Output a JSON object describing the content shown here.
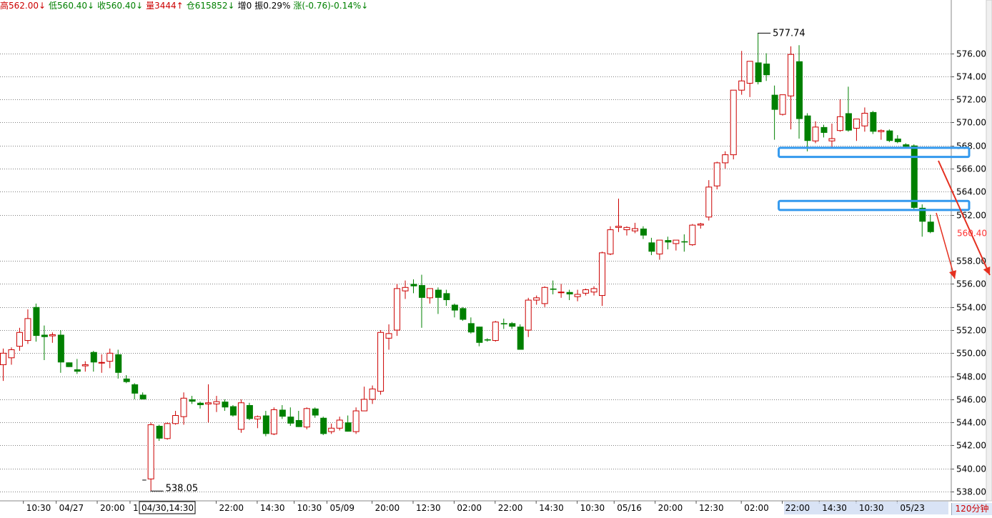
{
  "info_bar": {
    "high": "高562.00↓",
    "low": "低560.40↓",
    "close": "收560.40↓",
    "volume": "量3444↑",
    "open_interest": "仓615852↓",
    "increase": "增0",
    "amplitude": "振0.29%",
    "change": "涨(-0.76)-0.14%↓"
  },
  "timeframe_label": "120分钟",
  "current_price_label": "560.40",
  "high_marker": "577.74",
  "low_marker": "538.05",
  "cursor_time_label": "04/30,14:30",
  "colors": {
    "up": "#cc0000",
    "down": "#008000",
    "grid": "#808080",
    "highlight_box": "#3399ee",
    "arrow": "#e53020",
    "axis_text": "#000000"
  },
  "chart_data": {
    "type": "candlestick",
    "title": "",
    "xlabel": "",
    "ylabel": "",
    "ylim": [
      537.2,
      579.5
    ],
    "grid": true,
    "y_ticks": [
      "576.00",
      "574.00",
      "572.00",
      "570.00",
      "568.00",
      "566.00",
      "564.00",
      "562.00",
      "558.00",
      "556.00",
      "554.00",
      "552.00",
      "550.00",
      "548.00",
      "546.00",
      "544.00",
      "542.00",
      "540.00",
      "538.00"
    ],
    "x_ticks": [
      "10:30",
      "04/27",
      "20:00",
      "1",
      "22:00",
      "14:30",
      "10:30",
      "05/09",
      "20:00",
      "12:30",
      "02:00",
      "22:00",
      "14:30",
      "10:30",
      "05/16",
      "20:00",
      "12:30",
      "02:00",
      "22:00",
      "14:30",
      "10:30",
      "05/23"
    ],
    "x_tick_bars": [
      2.5,
      6.5,
      11.5,
      15.5,
      26,
      31,
      35.5,
      39.5,
      45,
      50,
      55,
      60,
      65,
      70,
      74.5,
      79.5,
      84.5,
      90,
      95,
      99.5,
      104,
      109
    ],
    "candles": [
      {
        "o": 549.0,
        "h": 550.4,
        "l": 547.6,
        "c": 550.0
      },
      {
        "o": 549.6,
        "h": 550.5,
        "l": 549.0,
        "c": 550.3
      },
      {
        "o": 550.6,
        "h": 552.2,
        "l": 550.2,
        "c": 551.8
      },
      {
        "o": 551.1,
        "h": 553.8,
        "l": 550.8,
        "c": 553.0
      },
      {
        "o": 554.0,
        "h": 554.3,
        "l": 551.0,
        "c": 551.5
      },
      {
        "o": 551.6,
        "h": 552.4,
        "l": 549.4,
        "c": 551.4
      },
      {
        "o": 551.5,
        "h": 551.8,
        "l": 550.9,
        "c": 551.6
      },
      {
        "o": 551.6,
        "h": 552.0,
        "l": 548.3,
        "c": 549.2
      },
      {
        "o": 549.2,
        "h": 549.2,
        "l": 548.8,
        "c": 548.8
      },
      {
        "o": 548.6,
        "h": 549.5,
        "l": 548.2,
        "c": 548.4
      },
      {
        "o": 548.9,
        "h": 549.3,
        "l": 548.4,
        "c": 549.0
      },
      {
        "o": 550.1,
        "h": 550.2,
        "l": 548.4,
        "c": 549.2
      },
      {
        "o": 549.2,
        "h": 549.9,
        "l": 548.3,
        "c": 549.2
      },
      {
        "o": 549.3,
        "h": 550.4,
        "l": 548.7,
        "c": 550.0
      },
      {
        "o": 549.9,
        "h": 550.3,
        "l": 547.8,
        "c": 548.3
      },
      {
        "o": 547.8,
        "h": 548.1,
        "l": 547.4,
        "c": 547.5
      },
      {
        "o": 547.3,
        "h": 547.4,
        "l": 546.0,
        "c": 546.5
      },
      {
        "o": 546.4,
        "h": 546.6,
        "l": 546.0,
        "c": 546.0
      },
      {
        "o": 539.1,
        "h": 544.0,
        "l": 538.05,
        "c": 543.8
      },
      {
        "o": 543.7,
        "h": 543.8,
        "l": 542.4,
        "c": 542.6
      },
      {
        "o": 542.6,
        "h": 544.0,
        "l": 542.5,
        "c": 543.9
      },
      {
        "o": 543.9,
        "h": 545.0,
        "l": 543.8,
        "c": 544.6
      },
      {
        "o": 544.5,
        "h": 546.6,
        "l": 543.8,
        "c": 546.1
      },
      {
        "o": 546.0,
        "h": 546.3,
        "l": 545.6,
        "c": 545.8
      },
      {
        "o": 545.7,
        "h": 545.8,
        "l": 545.2,
        "c": 545.5
      },
      {
        "o": 545.6,
        "h": 547.3,
        "l": 544.0,
        "c": 545.7
      },
      {
        "o": 545.6,
        "h": 546.3,
        "l": 544.9,
        "c": 545.8
      },
      {
        "o": 545.8,
        "h": 546.0,
        "l": 545.0,
        "c": 545.3
      },
      {
        "o": 545.4,
        "h": 545.5,
        "l": 544.5,
        "c": 544.6
      },
      {
        "o": 543.4,
        "h": 546.0,
        "l": 543.1,
        "c": 545.7
      },
      {
        "o": 545.5,
        "h": 545.7,
        "l": 544.2,
        "c": 544.3
      },
      {
        "o": 544.3,
        "h": 544.6,
        "l": 543.5,
        "c": 544.5
      },
      {
        "o": 544.6,
        "h": 545.0,
        "l": 542.8,
        "c": 543.0
      },
      {
        "o": 543.0,
        "h": 545.3,
        "l": 542.9,
        "c": 545.1
      },
      {
        "o": 545.1,
        "h": 545.5,
        "l": 544.3,
        "c": 544.5
      },
      {
        "o": 544.5,
        "h": 545.3,
        "l": 543.7,
        "c": 543.9
      },
      {
        "o": 544.2,
        "h": 545.0,
        "l": 543.6,
        "c": 543.6
      },
      {
        "o": 543.6,
        "h": 545.3,
        "l": 543.4,
        "c": 545.2
      },
      {
        "o": 545.2,
        "h": 545.3,
        "l": 544.4,
        "c": 544.6
      },
      {
        "o": 544.4,
        "h": 544.5,
        "l": 542.9,
        "c": 543.0
      },
      {
        "o": 543.2,
        "h": 543.9,
        "l": 543.0,
        "c": 543.5
      },
      {
        "o": 543.5,
        "h": 544.5,
        "l": 543.3,
        "c": 544.2
      },
      {
        "o": 544.0,
        "h": 544.6,
        "l": 543.2,
        "c": 543.2
      },
      {
        "o": 543.2,
        "h": 545.3,
        "l": 543.0,
        "c": 545.0
      },
      {
        "o": 545.0,
        "h": 547.1,
        "l": 545.0,
        "c": 546.0
      },
      {
        "o": 546.0,
        "h": 547.2,
        "l": 545.6,
        "c": 546.9
      },
      {
        "o": 546.7,
        "h": 552.0,
        "l": 546.4,
        "c": 551.8
      },
      {
        "o": 551.3,
        "h": 552.5,
        "l": 550.3,
        "c": 551.7
      },
      {
        "o": 552.0,
        "h": 556.0,
        "l": 551.5,
        "c": 555.6
      },
      {
        "o": 555.4,
        "h": 556.3,
        "l": 554.7,
        "c": 555.7
      },
      {
        "o": 556.0,
        "h": 556.4,
        "l": 555.2,
        "c": 555.8
      },
      {
        "o": 555.9,
        "h": 556.8,
        "l": 552.2,
        "c": 554.8
      },
      {
        "o": 554.8,
        "h": 555.5,
        "l": 554.3,
        "c": 555.6
      },
      {
        "o": 555.5,
        "h": 555.7,
        "l": 553.4,
        "c": 554.8
      },
      {
        "o": 555.2,
        "h": 555.5,
        "l": 554.1,
        "c": 554.6
      },
      {
        "o": 554.2,
        "h": 554.3,
        "l": 553.1,
        "c": 553.7
      },
      {
        "o": 553.9,
        "h": 554.0,
        "l": 552.8,
        "c": 552.9
      },
      {
        "o": 552.6,
        "h": 553.1,
        "l": 551.7,
        "c": 551.8
      },
      {
        "o": 552.3,
        "h": 552.3,
        "l": 550.6,
        "c": 550.9
      },
      {
        "o": 551.2,
        "h": 551.3,
        "l": 551.0,
        "c": 551.1
      },
      {
        "o": 551.1,
        "h": 552.8,
        "l": 551.0,
        "c": 552.7
      },
      {
        "o": 552.6,
        "h": 553.0,
        "l": 552.1,
        "c": 552.5
      },
      {
        "o": 552.6,
        "h": 552.7,
        "l": 552.1,
        "c": 552.3
      },
      {
        "o": 552.3,
        "h": 552.5,
        "l": 550.3,
        "c": 550.3
      },
      {
        "o": 552.0,
        "h": 554.8,
        "l": 551.4,
        "c": 554.6
      },
      {
        "o": 554.6,
        "h": 555.0,
        "l": 554.2,
        "c": 554.8
      },
      {
        "o": 554.3,
        "h": 555.8,
        "l": 554.0,
        "c": 555.7
      },
      {
        "o": 555.6,
        "h": 556.3,
        "l": 555.1,
        "c": 555.5
      },
      {
        "o": 555.3,
        "h": 556.0,
        "l": 554.8,
        "c": 555.3
      },
      {
        "o": 555.3,
        "h": 555.5,
        "l": 554.6,
        "c": 555.1
      },
      {
        "o": 554.9,
        "h": 555.5,
        "l": 554.5,
        "c": 555.1
      },
      {
        "o": 555.2,
        "h": 555.6,
        "l": 555.0,
        "c": 555.5
      },
      {
        "o": 555.3,
        "h": 555.8,
        "l": 555.0,
        "c": 555.6
      },
      {
        "o": 555.0,
        "h": 558.8,
        "l": 554.1,
        "c": 558.7
      },
      {
        "o": 558.6,
        "h": 561.0,
        "l": 558.5,
        "c": 560.7
      },
      {
        "o": 560.9,
        "h": 563.4,
        "l": 560.5,
        "c": 561.0
      },
      {
        "o": 560.7,
        "h": 561.0,
        "l": 560.2,
        "c": 560.9
      },
      {
        "o": 560.6,
        "h": 561.3,
        "l": 560.4,
        "c": 560.8
      },
      {
        "o": 560.8,
        "h": 561.0,
        "l": 559.9,
        "c": 560.2
      },
      {
        "o": 559.6,
        "h": 560.0,
        "l": 558.5,
        "c": 558.8
      },
      {
        "o": 558.6,
        "h": 559.8,
        "l": 558.1,
        "c": 559.8
      },
      {
        "o": 559.8,
        "h": 560.1,
        "l": 559.0,
        "c": 559.6
      },
      {
        "o": 559.5,
        "h": 559.8,
        "l": 558.9,
        "c": 559.8
      },
      {
        "o": 559.7,
        "h": 560.3,
        "l": 558.8,
        "c": 559.6
      },
      {
        "o": 559.4,
        "h": 561.2,
        "l": 559.3,
        "c": 561.1
      },
      {
        "o": 561.1,
        "h": 561.3,
        "l": 560.8,
        "c": 561.2
      },
      {
        "o": 561.8,
        "h": 565.0,
        "l": 561.5,
        "c": 564.4
      },
      {
        "o": 564.5,
        "h": 566.6,
        "l": 564.2,
        "c": 566.5
      },
      {
        "o": 566.5,
        "h": 567.5,
        "l": 566.0,
        "c": 567.2
      },
      {
        "o": 567.2,
        "h": 568.8,
        "l": 566.8,
        "c": 572.8
      },
      {
        "o": 572.8,
        "h": 576.2,
        "l": 572.4,
        "c": 573.6
      },
      {
        "o": 573.4,
        "h": 574.2,
        "l": 572.2,
        "c": 575.3
      },
      {
        "o": 575.2,
        "h": 577.74,
        "l": 573.3,
        "c": 573.5
      },
      {
        "o": 575.1,
        "h": 576.0,
        "l": 573.6,
        "c": 574.1
      },
      {
        "o": 572.4,
        "h": 573.2,
        "l": 568.5,
        "c": 571.1
      },
      {
        "o": 570.7,
        "h": 571.6,
        "l": 570.6,
        "c": 572.4
      },
      {
        "o": 572.3,
        "h": 576.6,
        "l": 569.4,
        "c": 575.9
      },
      {
        "o": 575.3,
        "h": 576.7,
        "l": 568.6,
        "c": 570.3
      },
      {
        "o": 570.6,
        "h": 570.8,
        "l": 567.5,
        "c": 568.4
      },
      {
        "o": 568.4,
        "h": 570.1,
        "l": 568.2,
        "c": 569.6
      },
      {
        "o": 569.6,
        "h": 569.8,
        "l": 568.7,
        "c": 569.1
      },
      {
        "o": 568.4,
        "h": 569.9,
        "l": 567.8,
        "c": 568.6
      },
      {
        "o": 569.3,
        "h": 572.0,
        "l": 569.2,
        "c": 570.5
      },
      {
        "o": 570.8,
        "h": 573.1,
        "l": 569.2,
        "c": 569.3
      },
      {
        "o": 569.5,
        "h": 570.2,
        "l": 568.4,
        "c": 570.3
      },
      {
        "o": 569.7,
        "h": 571.3,
        "l": 569.2,
        "c": 570.8
      },
      {
        "o": 570.9,
        "h": 571.0,
        "l": 569.0,
        "c": 569.2
      },
      {
        "o": 569.2,
        "h": 569.4,
        "l": 568.5,
        "c": 569.3
      },
      {
        "o": 569.3,
        "h": 569.4,
        "l": 568.3,
        "c": 568.4
      },
      {
        "o": 568.6,
        "h": 568.9,
        "l": 568.2,
        "c": 568.3
      },
      {
        "o": 568.1,
        "h": 568.2,
        "l": 567.8,
        "c": 567.9
      },
      {
        "o": 568.0,
        "h": 568.1,
        "l": 562.5,
        "c": 562.6
      },
      {
        "o": 562.6,
        "h": 562.9,
        "l": 560.1,
        "c": 561.4
      },
      {
        "o": 561.4,
        "h": 562.0,
        "l": 560.4,
        "c": 560.5
      }
    ]
  }
}
